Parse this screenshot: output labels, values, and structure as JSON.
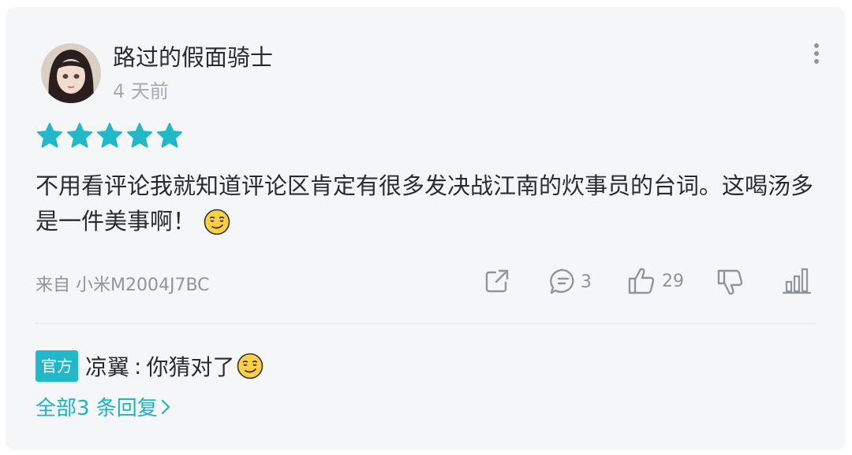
{
  "review": {
    "username": "路过的假面骑士",
    "time": "4 天前",
    "rating": 5,
    "content": "不用看评论我就知道评论区肯定有很多发决战江南的炊事员的台词。这喝汤多是一件美事啊！",
    "content_emoji": "smirk-emoji",
    "source": "来自 小米M2004J7BC",
    "comment_count": "3",
    "like_count": "29"
  },
  "reply": {
    "badge": "官方",
    "author": "凉翼",
    "separator": ":",
    "text": "你猜对了",
    "emoji": "smirk-emoji"
  },
  "all_replies_label": "全部3 条回复",
  "colors": {
    "accent": "#21b8c8",
    "card_bg": "#f4f6f8",
    "muted_text": "#8f959b"
  }
}
